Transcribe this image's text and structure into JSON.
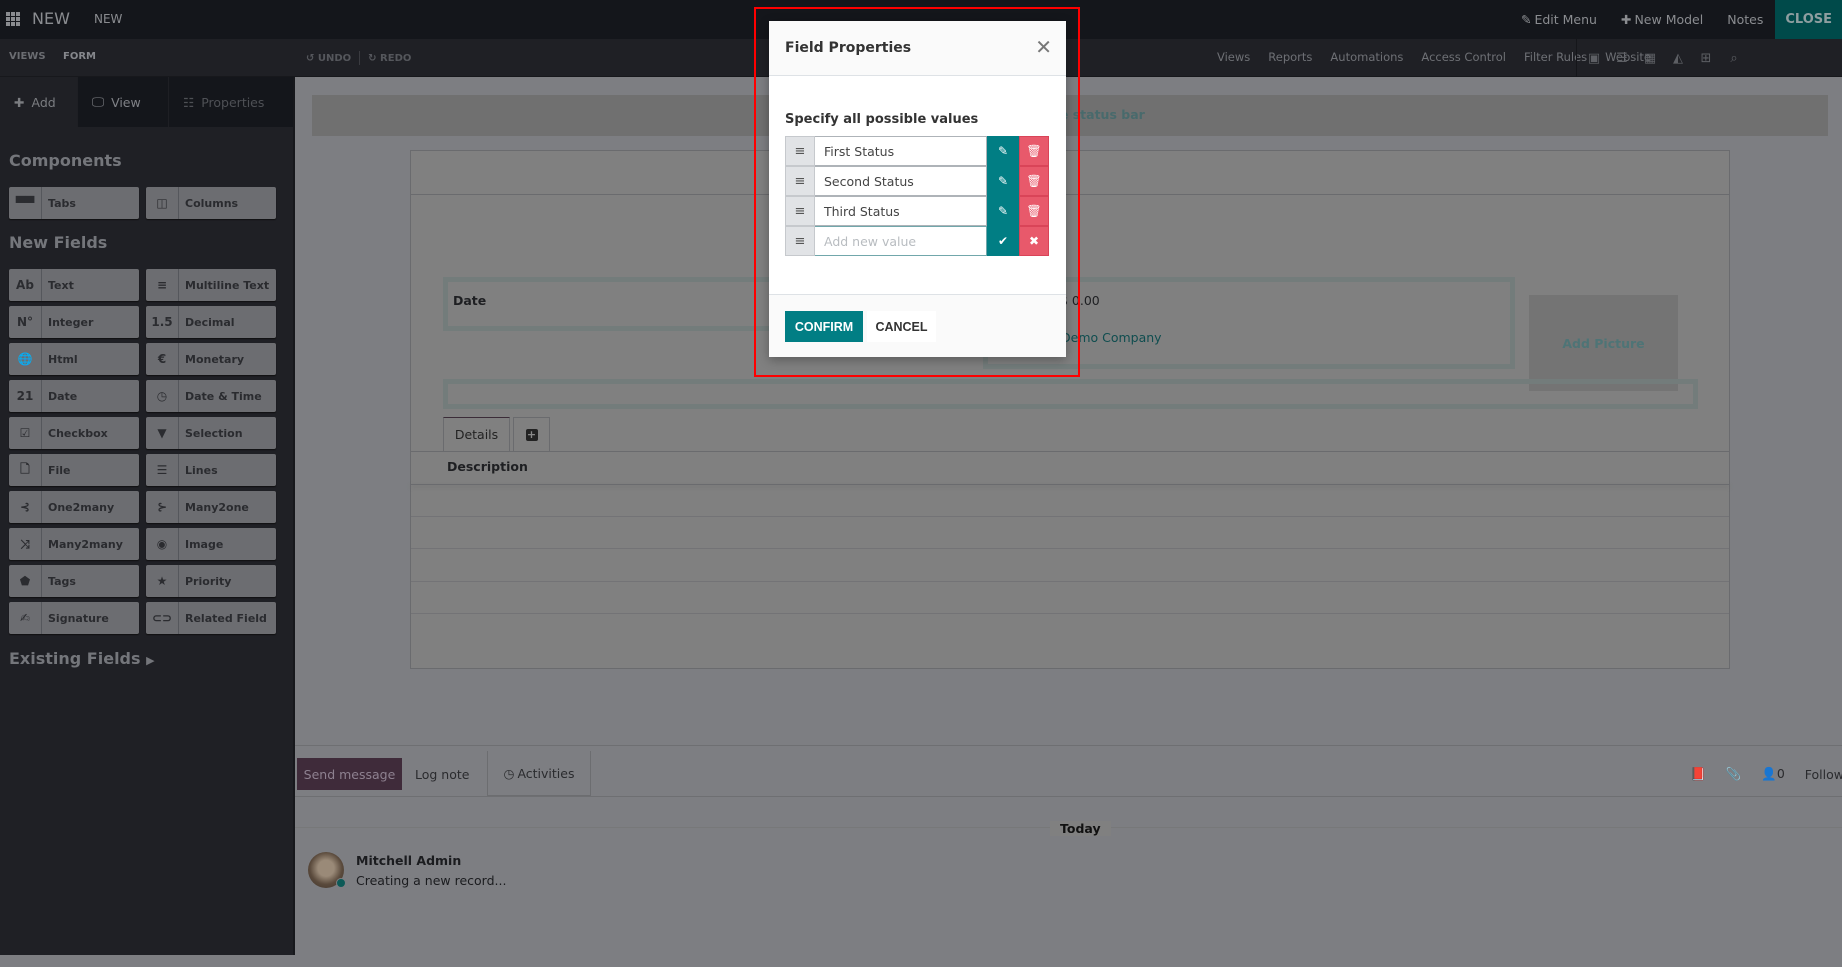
{
  "topbar": {
    "brand": "NEW",
    "breadcrumb": "NEW",
    "edit_menu": "Edit Menu",
    "new_model": "New Model",
    "notes": "Notes",
    "close": "CLOSE"
  },
  "subbar": {
    "breadcrumb_root": "VIEWS",
    "breadcrumb_current": "FORM",
    "undo": "UNDO",
    "redo": "REDO",
    "menus": [
      "Views",
      "Reports",
      "Automations",
      "Access Control",
      "Filter Rules",
      "Website"
    ],
    "view_switcher_icons": [
      "form-view-icon",
      "list-view-icon",
      "calendar-view-icon",
      "graph-view-icon",
      "pivot-view-icon",
      "search-view-icon"
    ]
  },
  "sidebar": {
    "tabs": [
      {
        "label": "Add",
        "icon": "plus-icon"
      },
      {
        "label": "View",
        "icon": "monitor-icon"
      },
      {
        "label": "Properties",
        "icon": "properties-icon"
      }
    ],
    "components_title": "Components",
    "components": [
      {
        "label": "Tabs",
        "icon": "tabs-icon"
      },
      {
        "label": "Columns",
        "icon": "columns-icon"
      }
    ],
    "new_fields_title": "New Fields",
    "new_fields": [
      {
        "label": "Text",
        "icon_text": "Ab"
      },
      {
        "label": "Multiline Text",
        "icon_text": "≡"
      },
      {
        "label": "Integer",
        "icon_text": "N°"
      },
      {
        "label": "Decimal",
        "icon_text": "1.5"
      },
      {
        "label": "Html",
        "icon_text": "🌐"
      },
      {
        "label": "Monetary",
        "icon_text": "€"
      },
      {
        "label": "Date",
        "icon_text": "21"
      },
      {
        "label": "Date & Time",
        "icon_text": "◷"
      },
      {
        "label": "Checkbox",
        "icon_text": "☑"
      },
      {
        "label": "Selection",
        "icon_text": "▼"
      },
      {
        "label": "File",
        "icon_text": "🗋"
      },
      {
        "label": "Lines",
        "icon_text": "☰"
      },
      {
        "label": "One2many",
        "icon_text": "⊰"
      },
      {
        "label": "Many2one",
        "icon_text": "⊱"
      },
      {
        "label": "Many2many",
        "icon_text": "⤨"
      },
      {
        "label": "Image",
        "icon_text": "◉"
      },
      {
        "label": "Tags",
        "icon_text": "⬟"
      },
      {
        "label": "Priority",
        "icon_text": "★"
      },
      {
        "label": "Signature",
        "icon_text": "✍"
      },
      {
        "label": "Related Field",
        "icon_text": "⊂⊃"
      }
    ],
    "existing_fields": "Existing Fields"
  },
  "form": {
    "statusbar_hint": "ne status bar",
    "date_label": "Date",
    "amount": "$ 0.00",
    "company": "Demo Company",
    "add_picture": "Add Picture",
    "notebook_tab": "Details",
    "description_label": "Description"
  },
  "chatter": {
    "send_message": "Send message",
    "log_note": "Log note",
    "activities": "Activities",
    "followers_count": "0",
    "follow": "Follow",
    "today": "Today",
    "author": "Mitchell Admin",
    "message": "Creating a new record..."
  },
  "dialog": {
    "title": "Field Properties",
    "subtitle": "Specify all possible values",
    "values": [
      "First Status",
      "Second Status",
      "Third Status"
    ],
    "new_value_placeholder": "Add new value",
    "confirm": "CONFIRM",
    "cancel": "CANCEL"
  },
  "colors": {
    "primary": "#017e84",
    "danger": "#e8596b",
    "highlight_outline": "#ff0000"
  }
}
